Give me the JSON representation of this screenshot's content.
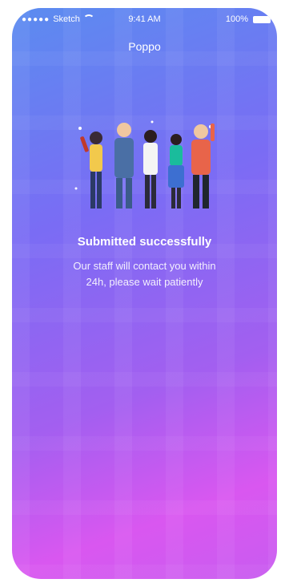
{
  "statusbar": {
    "carrier": "Sketch",
    "time": "9:41 AM",
    "battery": "100%"
  },
  "header": {
    "title": "Poppo"
  },
  "message": {
    "headline": "Submitted successfully",
    "body_line1": "Our staff will contact you within",
    "body_line2": "24h, please wait patiently"
  },
  "colors": {
    "gradient_top": "#5b8cf0",
    "gradient_bottom": "#d957f0"
  }
}
